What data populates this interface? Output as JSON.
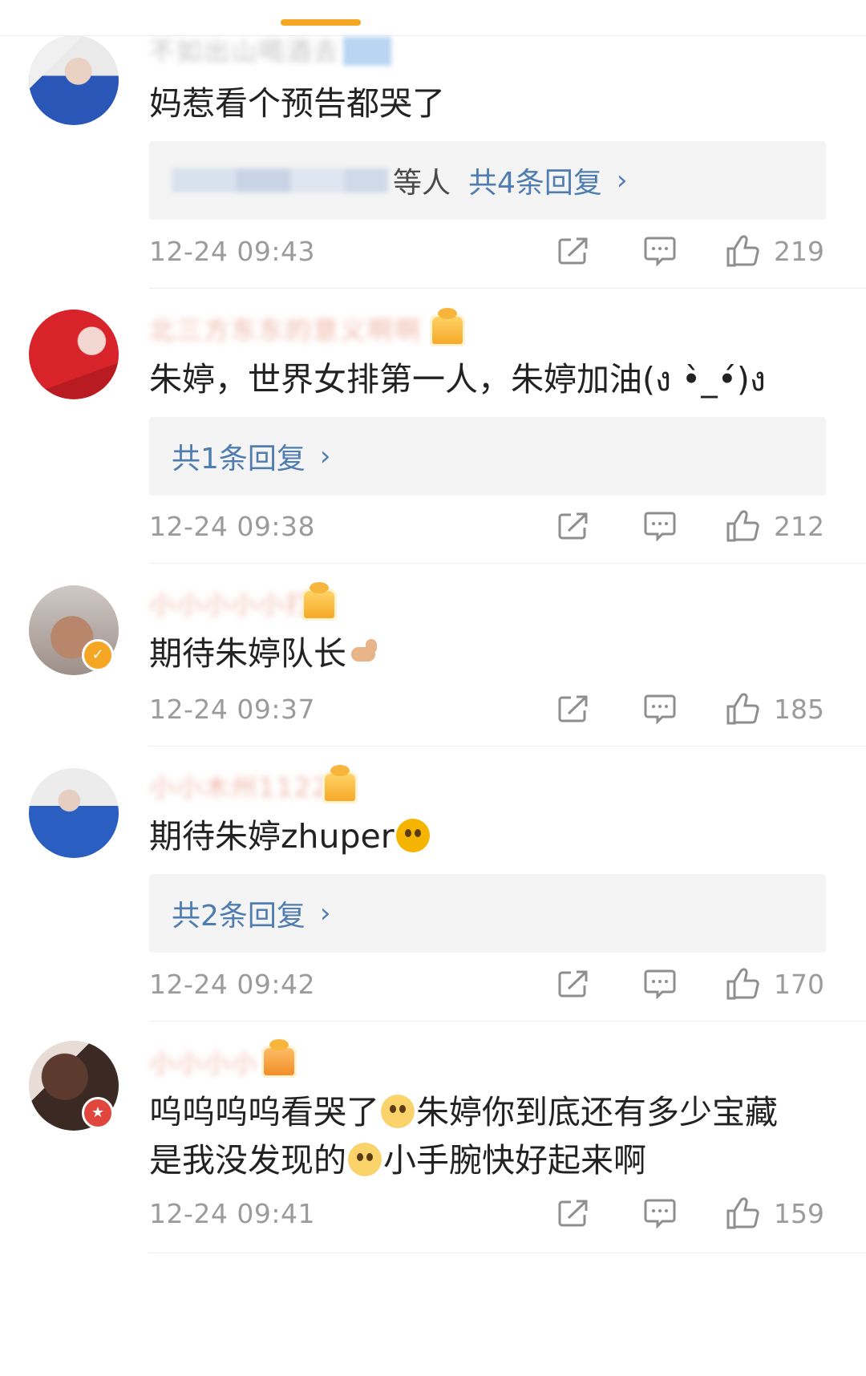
{
  "comments": [
    {
      "username": "不如出山喝酒去",
      "text": "妈惹看个预告都哭了",
      "reply_label": "共4条回复",
      "reply_prefix": "等人",
      "timestamp": "12-24 09:43",
      "likes": "219"
    },
    {
      "username": "北三方东东的意义啊啊",
      "text": "朱婷，世界女排第一人，朱婷加油(ง •̀_•́)ง",
      "reply_label": "共1条回复",
      "timestamp": "12-24 09:38",
      "likes": "212"
    },
    {
      "username": "小小小小小打",
      "text": "期待朱婷队长",
      "timestamp": "12-24 09:37",
      "likes": "185"
    },
    {
      "username": "小小木州1122",
      "text": "期待朱婷zhuper",
      "reply_label": "共2条回复",
      "timestamp": "12-24 09:42",
      "likes": "170"
    },
    {
      "username": "小小小小",
      "text_line1": "呜呜呜呜看哭了",
      "text_line1b": "朱婷你到底还有多少宝藏",
      "text_line2a": "是我没发现的",
      "text_line2b": "小手腕快好起来啊",
      "timestamp": "12-24 09:41",
      "likes": "159"
    }
  ],
  "colors": {
    "accent": "#f5a623",
    "link": "#507daf",
    "meta_text": "#9b9b9b",
    "reply_bg": "#f4f4f4"
  },
  "icons": [
    "share-icon",
    "comment-icon",
    "like-icon",
    "chevron-right-icon",
    "verified-badge-icon"
  ]
}
